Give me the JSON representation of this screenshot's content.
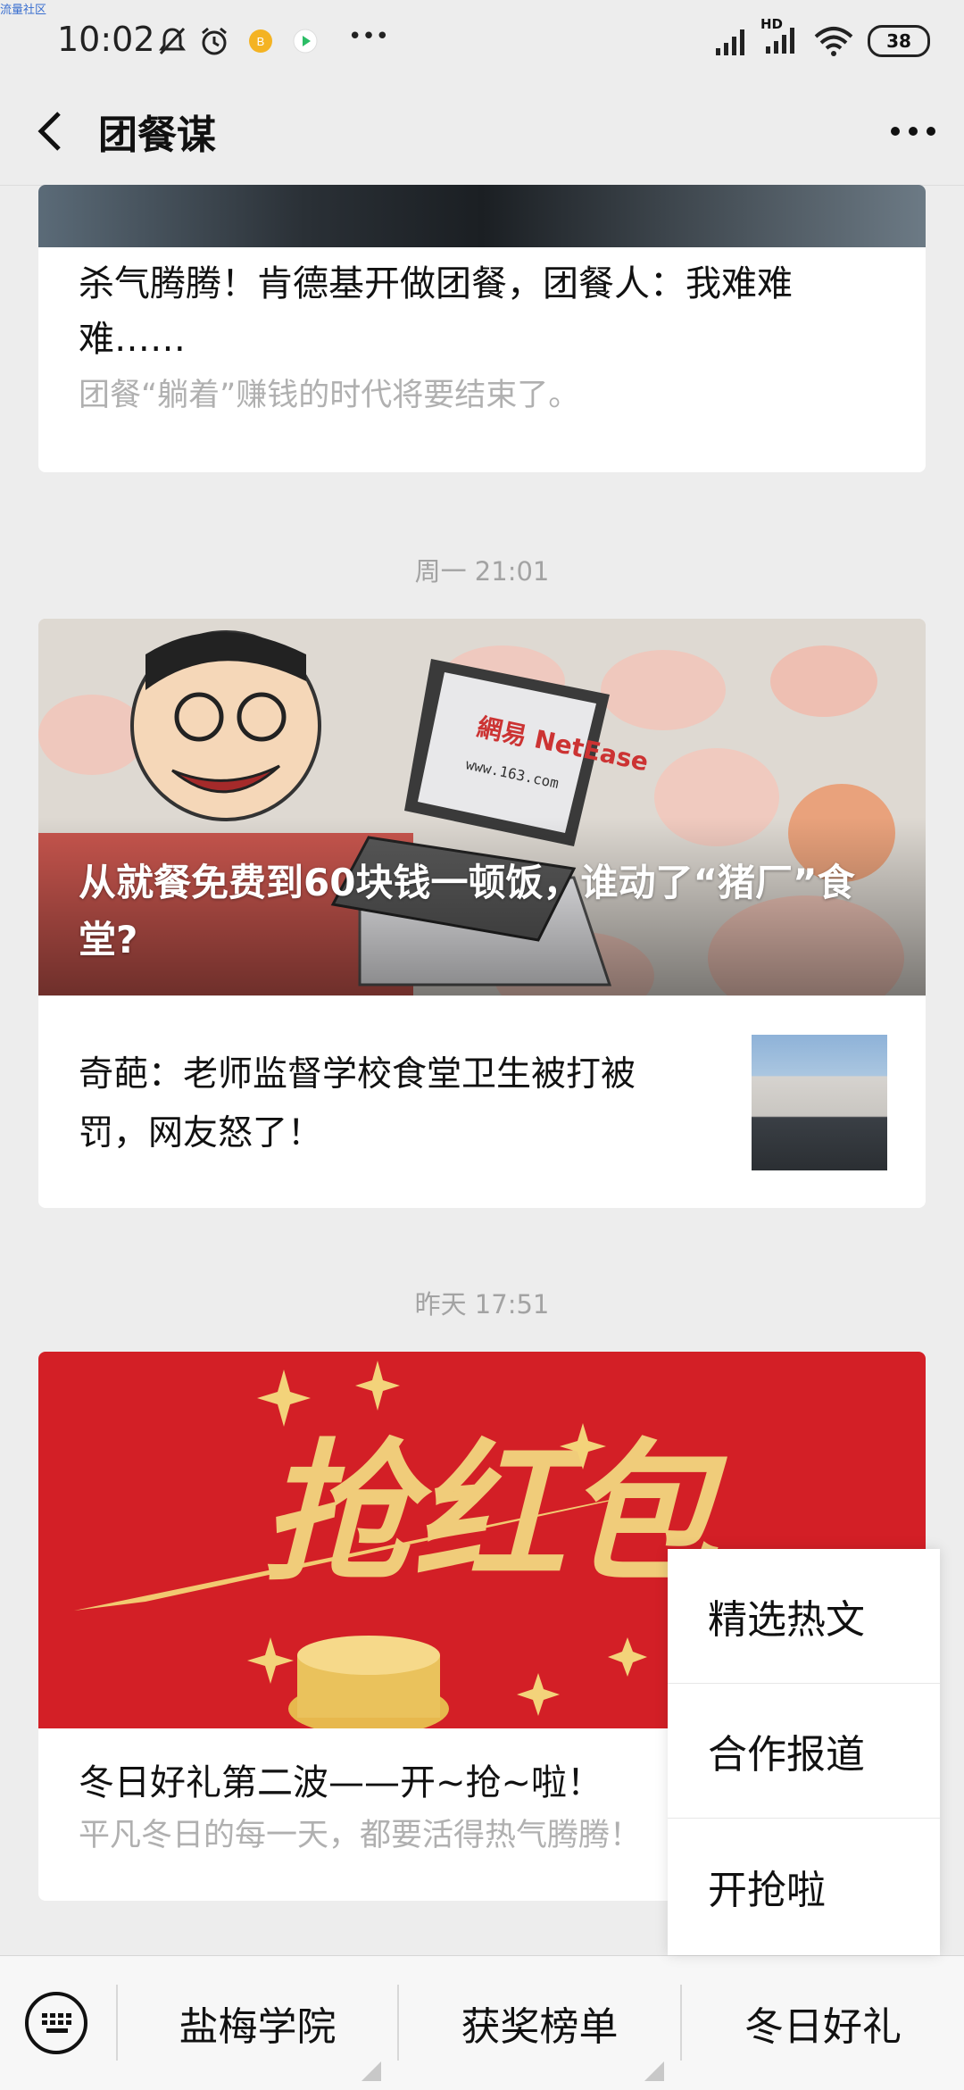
{
  "watermark": "流量社区",
  "status": {
    "time": "10:02",
    "battery": "38",
    "hd": "HD",
    "dots": "•••"
  },
  "header": {
    "title": "团餐谋"
  },
  "articles": {
    "a1": {
      "title": "杀气腾腾！肯德基开做团餐，团餐人：我难难难……",
      "summary": "团餐“躺着”赚钱的时代将要结束了。"
    },
    "t2": "周一 21:01",
    "a2": {
      "cover_title": "从就餐免费到60块钱一顿饭，谁动了“猪厂”食堂?",
      "laptop_text": "網易 NetEase",
      "laptop_url": "www.163.com"
    },
    "a3": {
      "title": "奇葩：老师监督学校食堂卫生被打被罚，网友怒了！"
    },
    "t3": "昨天 17:51",
    "a4": {
      "banner_text": "抢红包",
      "title": "冬日好礼第二波——开~抢~啦！",
      "summary": "平凡冬日的每一天，都要活得热气腾腾！"
    }
  },
  "bottom_menu": {
    "items": [
      "盐梅学院",
      "获奖榜单",
      "冬日好礼"
    ]
  },
  "popup": {
    "items": [
      "精选热文",
      "合作报道",
      "开抢啦"
    ]
  }
}
